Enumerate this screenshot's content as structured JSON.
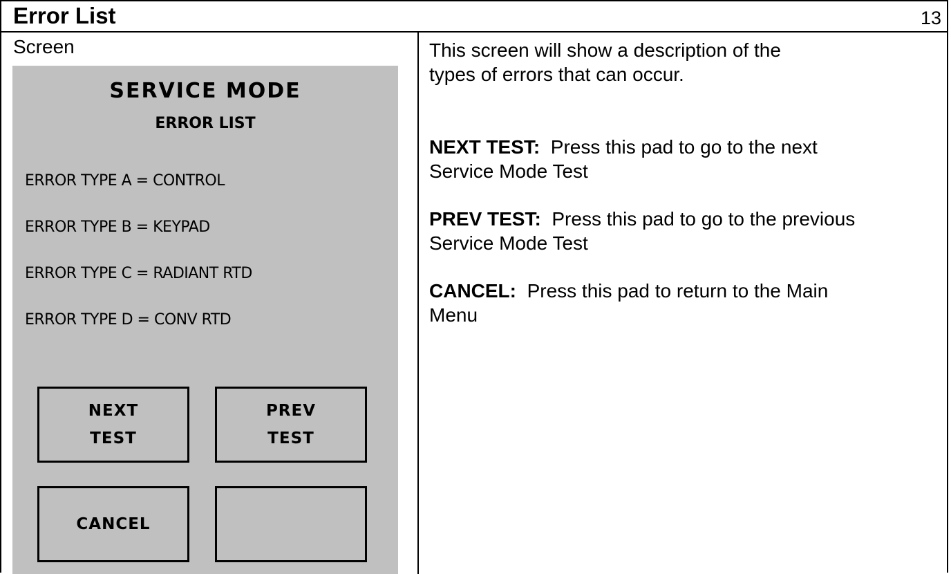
{
  "header": {
    "title": "Error List",
    "page_number": "13"
  },
  "left": {
    "label": "Screen"
  },
  "screen": {
    "title": "SERVICE MODE",
    "subtitle": "ERROR LIST",
    "errors": [
      "ERROR TYPE A = CONTROL",
      "ERROR TYPE B = KEYPAD",
      "ERROR TYPE C = RADIANT RTD",
      "ERROR TYPE D = CONV RTD"
    ],
    "buttons": {
      "next_line1": "NEXT",
      "next_line2": "TEST",
      "prev_line1": "PREV",
      "prev_line2": "TEST",
      "cancel": "CANCEL",
      "blank": ""
    },
    "background_color": "#c0c0c0"
  },
  "description": {
    "intro": "This screen will show a description of the types of errors that can occur.",
    "items": [
      {
        "term": "NEXT TEST:",
        "text": "Press this pad to go to the next Service Mode Test"
      },
      {
        "term": "PREV TEST:",
        "text": "Press this pad to go to the previous Service Mode Test"
      },
      {
        "term": "CANCEL:",
        "text": "Press this pad to return to the Main Menu"
      }
    ]
  }
}
